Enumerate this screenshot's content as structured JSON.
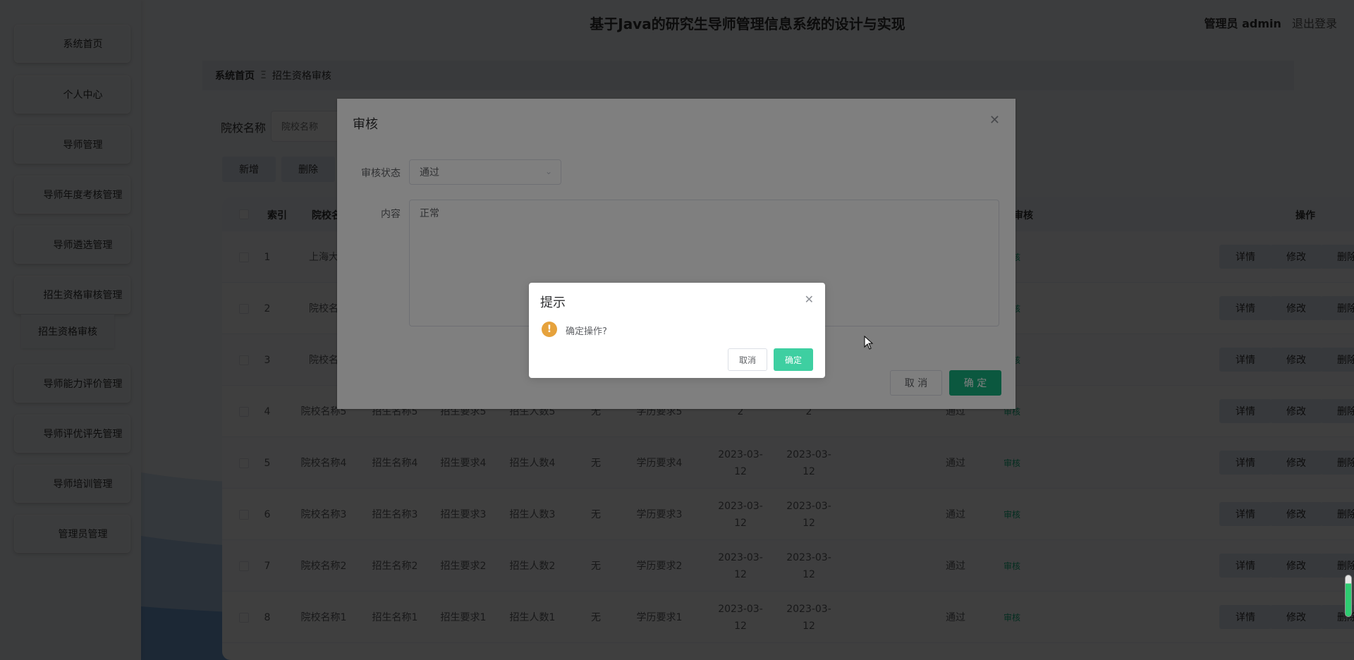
{
  "app": {
    "title": "基于Java的研究生导师管理信息系统的设计与实现"
  },
  "user": {
    "name": "管理员 admin",
    "logout": "退出登录"
  },
  "sidebar": {
    "items": [
      {
        "label": "系统首页"
      },
      {
        "label": "个人中心"
      },
      {
        "label": "导师管理"
      },
      {
        "label": "导师年度考核管理"
      },
      {
        "label": "导师遴选管理"
      },
      {
        "label": "招生资格审核管理"
      },
      {
        "label": "导师能力评价管理"
      },
      {
        "label": "导师评优评先管理"
      },
      {
        "label": "导师培训管理"
      },
      {
        "label": "管理员管理"
      }
    ],
    "subitem": {
      "label": "招生资格审核"
    }
  },
  "breadcrumb": {
    "home": "系统首页",
    "separator": "Ξ",
    "current": "招生资格审核"
  },
  "search": {
    "label": "院校名称",
    "placeholder": "院校名称"
  },
  "toolbar": {
    "add": "新增",
    "delete": "删除"
  },
  "table": {
    "headers": {
      "index": "索引",
      "school": "院校名称",
      "review": "审核",
      "ops": "操作"
    },
    "rows": [
      {
        "index": "1",
        "school": "上海大",
        "name": "",
        "req": "",
        "count": "",
        "none": "",
        "edu": "",
        "d1": "",
        "d2": "",
        "status": "",
        "review": "审核"
      },
      {
        "index": "2",
        "school": "院校名",
        "name": "",
        "req": "",
        "count": "",
        "none": "",
        "edu": "",
        "d1": "",
        "d2": "",
        "status": "",
        "review": "审核"
      },
      {
        "index": "3",
        "school": "院校名",
        "name": "",
        "req": "",
        "count": "",
        "none": "",
        "edu": "",
        "d1": "",
        "d2": "",
        "status": "",
        "review": "审核"
      },
      {
        "index": "4",
        "school": "院校名称5",
        "name": "招生名称5",
        "req": "招生要求5",
        "count": "招生人数5",
        "none": "无",
        "edu": "学历要求5",
        "d1": "2",
        "d2": "2",
        "status": "通过",
        "review": "审核"
      },
      {
        "index": "5",
        "school": "院校名称4",
        "name": "招生名称4",
        "req": "招生要求4",
        "count": "招生人数4",
        "none": "无",
        "edu": "学历要求4",
        "d1": "2023-03-12",
        "d2": "2023-03-12",
        "status": "通过",
        "review": "审核"
      },
      {
        "index": "6",
        "school": "院校名称3",
        "name": "招生名称3",
        "req": "招生要求3",
        "count": "招生人数3",
        "none": "无",
        "edu": "学历要求3",
        "d1": "2023-03-12",
        "d2": "2023-03-12",
        "status": "通过",
        "review": "审核"
      },
      {
        "index": "7",
        "school": "院校名称2",
        "name": "招生名称2",
        "req": "招生要求2",
        "count": "招生人数2",
        "none": "无",
        "edu": "学历要求2",
        "d1": "2023-03-12",
        "d2": "2023-03-12",
        "status": "通过",
        "review": "审核"
      },
      {
        "index": "8",
        "school": "院校名称1",
        "name": "招生名称1",
        "req": "招生要求1",
        "count": "招生人数1",
        "none": "无",
        "edu": "学历要求1",
        "d1": "2023-03-12",
        "d2": "2023-03-12",
        "status": "通过",
        "review": "审核"
      }
    ],
    "ops": {
      "detail": "详情",
      "edit": "修改",
      "delete": "删除"
    }
  },
  "dialog": {
    "title": "审核",
    "status_label": "审核状态",
    "status_value": "通过",
    "content_label": "内容",
    "content_value": "正常",
    "cancel": "取 消",
    "ok": "确 定"
  },
  "confirm": {
    "title": "提示",
    "message": "确定操作?",
    "cancel": "取消",
    "ok": "确定"
  },
  "colors": {
    "accent": "#17b07f",
    "confirm_ok": "#3ecfa1",
    "warning": "#e6a23c",
    "link_green": "#13b580"
  }
}
